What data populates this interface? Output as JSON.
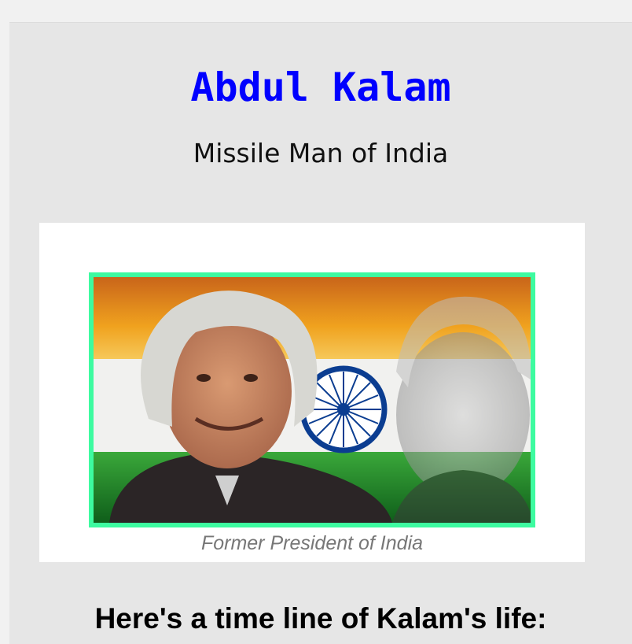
{
  "header": {
    "title": "Abdul Kalam",
    "subtitle": "Missile Man of India"
  },
  "figure": {
    "image_icon": "portrait-with-indian-flag-image",
    "caption": "Former President of India"
  },
  "timeline": {
    "heading": "Here's a time line of Kalam's life:"
  },
  "colors": {
    "title": "#0000ff",
    "image_border": "#3dfba0",
    "caption": "#777777",
    "page_background": "#e6e6e6",
    "flag_saffron": "#f0931c",
    "flag_green": "#1f8a2a",
    "chakra_blue": "#0b3d91"
  }
}
